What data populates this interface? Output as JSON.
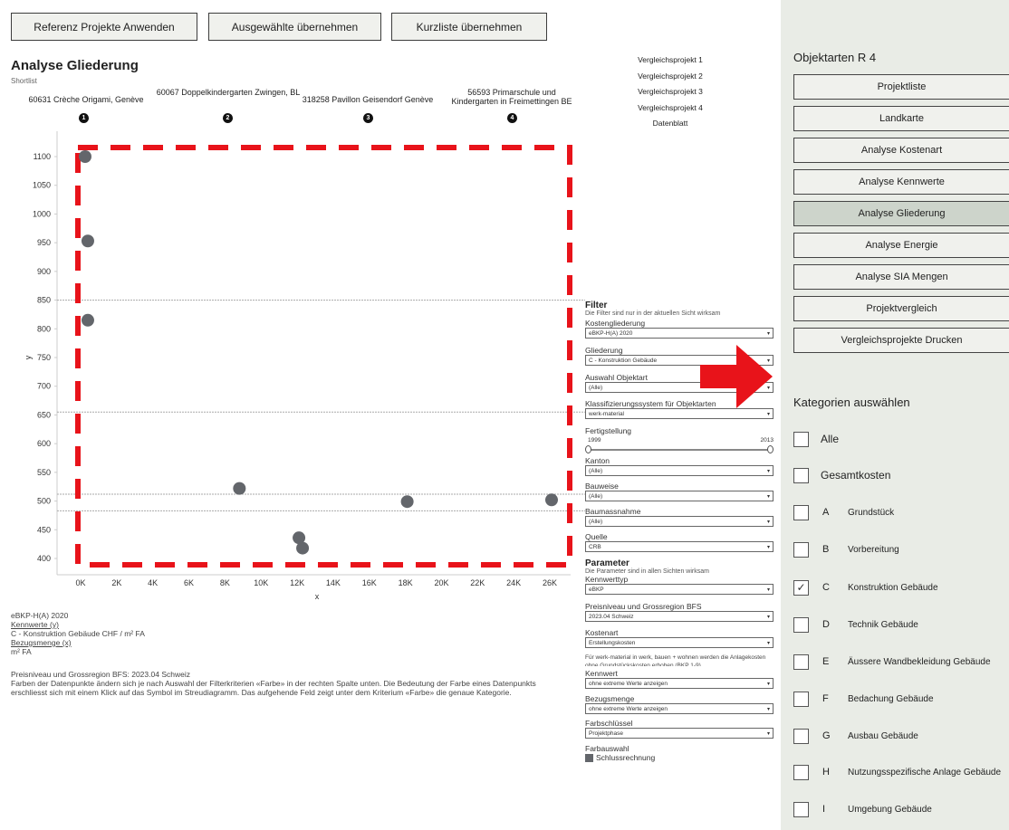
{
  "toolbar": {
    "btn_referenz": "Referenz Projekte Anwenden",
    "btn_ausgewaehlte": "Ausgewählte übernehmen",
    "btn_kurzliste": "Kurzliste übernehmen"
  },
  "main": {
    "title": "Analyse Gliederung",
    "shortlist": "Shortlist",
    "projects": [
      {
        "name": "60631 Crèche Origami, Genève",
        "num": "1"
      },
      {
        "name": "60067 Doppelkindergarten Zwingen, BL",
        "num": "2"
      },
      {
        "name": "318258 Pavillon Geisendorf Genève",
        "num": "3"
      },
      {
        "name": "56593 Primarschule und Kindergarten in Freimettingen BE",
        "num": "4"
      }
    ],
    "vergleich": [
      "Vergleichsprojekt 1",
      "Vergleichsprojekt 2",
      "Vergleichsprojekt 3",
      "Vergleichsprojekt 4",
      "Datenblatt"
    ]
  },
  "chart_data": {
    "type": "scatter",
    "xlabel": "x",
    "ylabel": "y",
    "x_ticks": [
      "0K",
      "2K",
      "4K",
      "6K",
      "8K",
      "10K",
      "12K",
      "14K",
      "16K",
      "18K",
      "20K",
      "22K",
      "24K",
      "26K"
    ],
    "y_ticks": [
      "400",
      "450",
      "500",
      "550",
      "600",
      "650",
      "700",
      "750",
      "800",
      "850",
      "900",
      "950",
      "1000",
      "1050",
      "1100"
    ],
    "xlim": [
      0,
      27000
    ],
    "ylim": [
      385,
      1125
    ],
    "reference_lines_y": [
      850,
      655,
      512,
      483
    ],
    "points": [
      {
        "x": 250,
        "y": 1100
      },
      {
        "x": 400,
        "y": 953
      },
      {
        "x": 400,
        "y": 815
      },
      {
        "x": 8800,
        "y": 522
      },
      {
        "x": 12100,
        "y": 436
      },
      {
        "x": 12300,
        "y": 418
      },
      {
        "x": 18100,
        "y": 499
      },
      {
        "x": 26100,
        "y": 502
      }
    ],
    "point_color": "#63666b",
    "selection_color": "#e8131a"
  },
  "info": {
    "l1": "eBKP-H(A) 2020",
    "l2": "Kennwerte (y)",
    "l3": "C - Konstruktion Gebäude CHF / m² FA",
    "l4": "Bezugsmenge (x)",
    "l5": "m² FA",
    "l6": "Preisniveau und Grossregion BFS: 2023.04 Schweiz",
    "l7": "Farben der Datenpunkte ändern sich je nach Auswahl der Filterkriterien «Farbe» in der rechten Spalte unten. Die Bedeutung der Farbe eines Datenpunkts erschliesst sich mit einem Klick auf das Symbol im Streudiagramm. Das aufgehende Feld zeigt unter dem Kriterium «Farbe» die genaue Kategorie."
  },
  "filter": {
    "title": "Filter",
    "subtitle": "Die Filter sind nur in der aktuellen Sicht wirksam",
    "kostengliederung_label": "Kostengliederung",
    "kostengliederung_value": "eBKP-H(A) 2020",
    "gliederung_label": "Gliederung",
    "gliederung_value": "C - Konstruktion Gebäude",
    "objektart_label": "Auswahl Objektart",
    "objektart_value": "(Alle)",
    "klass_label": "Klassifizierungssystem für Objektarten",
    "klass_value": "werk-material",
    "fertig_label": "Fertigstellung",
    "fertig_min": "1999",
    "fertig_max": "2013",
    "kanton_label": "Kanton",
    "kanton_value": "(Alle)",
    "bauweise_label": "Bauweise",
    "bauweise_value": "(Alle)",
    "baumass_label": "Baumassnahme",
    "baumass_value": "(Alle)",
    "quelle_label": "Quelle",
    "quelle_value": "CRB"
  },
  "parameter": {
    "title": "Parameter",
    "subtitle": "Die Parameter sind in allen Sichten wirksam",
    "kennwerttyp_label": "Kennwerttyp",
    "kennwerttyp_value": "eBKP",
    "preis_label": "Preisniveau und Grossregion BFS",
    "preis_value": "2023.04 Schweiz",
    "kostenart_label": "Kostenart",
    "kostenart_value": "Erstellungskosten",
    "note": "Für werk-material in werk, bauen + wohnen werden die Anlagekosten ohne Grundstückskosten erhoben (BKP 1-9)",
    "kennwert_label": "Kennwert",
    "kennwert_value": "ohne extreme Werte anzeigen",
    "bezug_label": "Bezugsmenge",
    "bezug_value": "ohne extreme Werte anzeigen",
    "farbschl_label": "Farbschlüssel",
    "farbschl_value": "Projektphase",
    "farbauswahl_label": "Farbauswahl",
    "farbauswahl_item": "Schlussrechnung"
  },
  "sidebar": {
    "title": "Objektarten R 4",
    "buttons": [
      "Projektliste",
      "Landkarte",
      "Analyse Kostenart",
      "Analyse Kennwerte",
      "Analyse Gliederung",
      "Analyse Energie",
      "Analyse SIA Mengen",
      "Projektvergleich",
      "Vergleichsprojekte Drucken"
    ],
    "kat_title": "Kategorien auswählen",
    "categories": [
      {
        "code": "",
        "label": "Alle",
        "checked": false
      },
      {
        "code": "",
        "label": "Gesamtkosten",
        "checked": false
      },
      {
        "code": "A",
        "label": "Grundstück",
        "checked": false
      },
      {
        "code": "B",
        "label": "Vorbereitung",
        "checked": false
      },
      {
        "code": "C",
        "label": "Konstruktion Gebäude",
        "checked": true
      },
      {
        "code": "D",
        "label": "Technik Gebäude",
        "checked": false
      },
      {
        "code": "E",
        "label": "Äussere Wandbekleidung Gebäude",
        "checked": false
      },
      {
        "code": "F",
        "label": "Bedachung Gebäude",
        "checked": false
      },
      {
        "code": "G",
        "label": "Ausbau Gebäude",
        "checked": false
      },
      {
        "code": "H",
        "label": "Nutzungsspezifische Anlage Gebäude",
        "checked": false
      },
      {
        "code": "I",
        "label": "Umgebung Gebäude",
        "checked": false
      }
    ],
    "check_mark": "✓"
  }
}
